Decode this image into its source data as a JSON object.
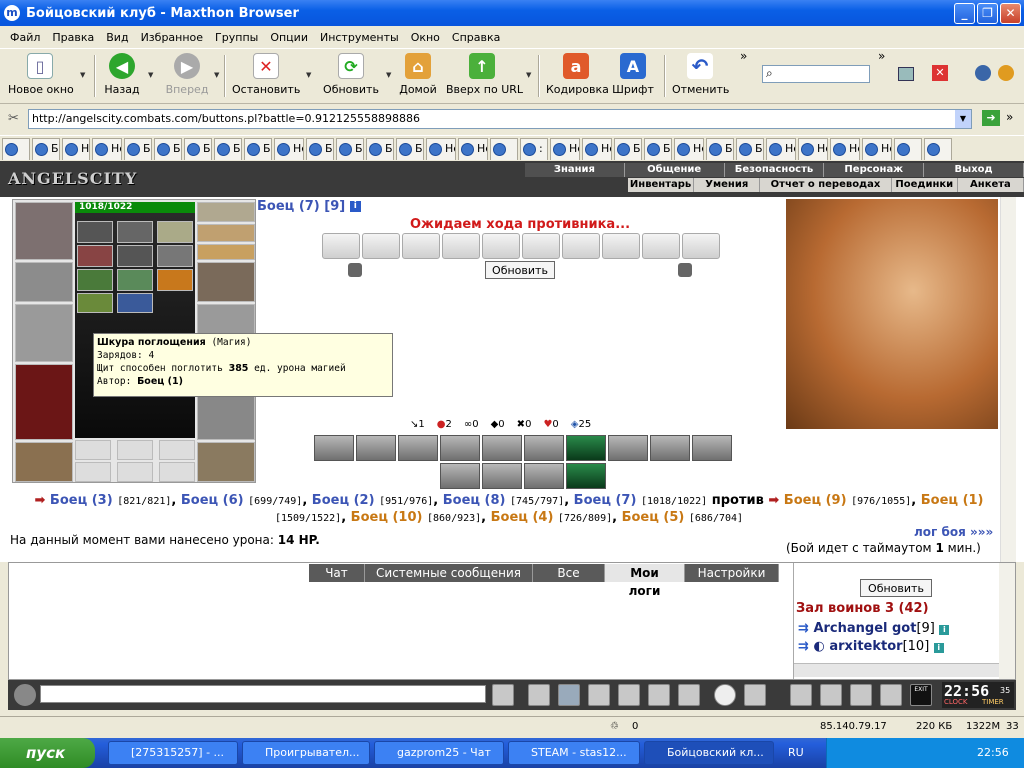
{
  "window": {
    "title": "Бойцовский клуб - Maxthon Browser",
    "icon": "m"
  },
  "menu": [
    "Файл",
    "Правка",
    "Вид",
    "Избранное",
    "Группы",
    "Опции",
    "Инструменты",
    "Окно",
    "Справка"
  ],
  "toolbar": {
    "new_tab": "Новое окно",
    "back": "Назад",
    "forward": "Вперед",
    "stop": "Остановить",
    "refresh": "Обновить",
    "home": "Домой",
    "up_url": "Вверх по URL",
    "encoding": "Кодировка",
    "font": "Шрифт",
    "undo": "Отменить"
  },
  "address": {
    "url": "http://angelscity.combats.com/buttons.pl?battle=0.912125558898886"
  },
  "tabs": [
    "",
    "Б.",
    "Н.",
    "Не...",
    "Б.",
    "Б.",
    "Б.",
    "Б.",
    "Б.",
    "Не...",
    "Б.",
    "Б.",
    "Б.",
    "Б.",
    "Не...",
    "Не...",
    "",
    ":",
    "Не...",
    "Не...",
    "Б.",
    "Б.",
    "Не...",
    "Б.",
    "Б.",
    "Не...",
    "Не...",
    "Не...",
    "Не...",
    "",
    ""
  ],
  "game": {
    "logo": "ANGELSCITY",
    "nav_top": [
      "Знания",
      "Общение",
      "Безопасность",
      "Персонаж",
      "Выход"
    ],
    "nav_bottom": [
      "Инвентарь",
      "Умения",
      "Отчет о переводах",
      "Поединки",
      "Анкета"
    ],
    "hp": "1018/1022",
    "opponent": "Боец (7) [9]",
    "waiting": "Ожидаем хода противника...",
    "refresh_btn": "Обновить",
    "stats": [
      {
        "icon": "sword-icon",
        "value": "1"
      },
      {
        "icon": "blood-drop-icon",
        "value": "2"
      },
      {
        "icon": "chain-icon",
        "value": "0"
      },
      {
        "icon": "shield-icon",
        "value": "0"
      },
      {
        "icon": "cross-icon",
        "value": "0"
      },
      {
        "icon": "heart-icon",
        "value": "0"
      },
      {
        "icon": "mana-shield-icon",
        "value": "25"
      }
    ],
    "tooltip": {
      "name": "Шкура поглощения",
      "type": "(Магия)",
      "charges": "Зарядов: 4",
      "desc_pre": "Щит способен поглотить",
      "desc_val": "385",
      "desc_post": "ед. урона магией",
      "author_label": "Автор:",
      "author": "Боец (1)"
    },
    "team_blue": [
      {
        "name": "Боец (3)",
        "hp": "[821/821]"
      },
      {
        "name": "Боец (6)",
        "hp": "[699/749]"
      },
      {
        "name": "Боец (2)",
        "hp": "[951/976]"
      },
      {
        "name": "Боец (8)",
        "hp": "[745/797]"
      },
      {
        "name": "Боец (7)",
        "hp": "[1018/1022]"
      }
    ],
    "vs": "против",
    "team_orange": [
      {
        "name": "Боец (9)",
        "hp": "[976/1055]"
      },
      {
        "name": "Боец (1)",
        "hp": "[1509/1522]"
      },
      {
        "name": "Боец (10)",
        "hp": "[860/923]"
      },
      {
        "name": "Боец (4)",
        "hp": "[726/809]"
      },
      {
        "name": "Боец (5)",
        "hp": "[686/704]"
      }
    ],
    "damage_label": "На данный момент вами нанесено урона:",
    "damage_value": "14 HP.",
    "log_link": "лог боя »»»",
    "timeout_pre": "(Бой идет с таймаутом",
    "timeout_val": "1",
    "timeout_post": "мин.)"
  },
  "chat": {
    "tabs": [
      "Чат",
      "Системные сообщения",
      "Все логи",
      "Мои логи",
      "Настройки"
    ],
    "active_tab": "Мои логи",
    "room_refresh": "Обновить",
    "room_title": "Зал воинов 3 (42)",
    "players": [
      {
        "name": "Archangel got",
        "level": "[9]"
      },
      {
        "name": "arxitektor",
        "level": "[10]"
      }
    ],
    "clock": "22:56",
    "clock_sec": "35",
    "clock_label": "CLOCK",
    "timer_label": "TIMER",
    "exit_label": "EXIT"
  },
  "status": {
    "ip": "85.140.79.17",
    "kb": "220 КБ",
    "mem": "1322M",
    "num": "33"
  },
  "taskbar": {
    "start": "пуск",
    "tasks": [
      "[275315257] - ...",
      "Проигрывател...",
      "gazprom25 - Чат",
      "STEAM - stas12...",
      "Бойцовский кл..."
    ],
    "lang": "RU",
    "time": "22:56"
  },
  "colors": {
    "accent_red": "#d11a1a",
    "team_blue": "#3c55b5",
    "team_orange": "#c87814",
    "hp_green": "#0a8a0a"
  }
}
